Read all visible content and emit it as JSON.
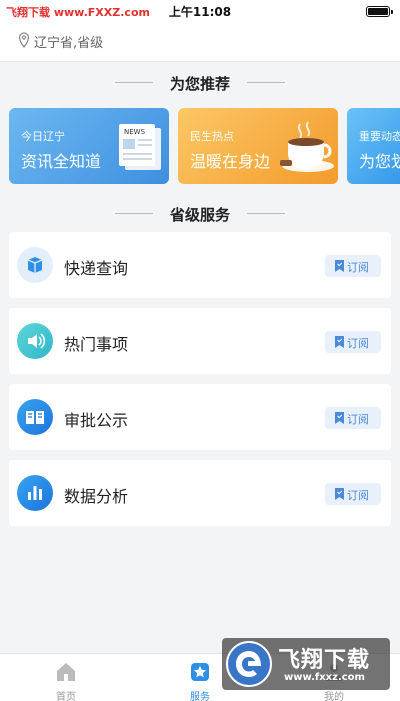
{
  "status_bar": {
    "carrier": "飞翔下载 www.FXXZ.com",
    "time": "上午11:08"
  },
  "location": {
    "text": "辽宁省,省级"
  },
  "recommend": {
    "title": "为您推荐",
    "cards": [
      {
        "sub": "今日辽宁",
        "main": "资讯全知道",
        "badge": "NEWS"
      },
      {
        "sub": "民生热点",
        "main": "温暖在身边"
      },
      {
        "sub": "重要动态",
        "main": "为您划"
      }
    ]
  },
  "services": {
    "title": "省级服务",
    "subscribe_label": "订阅",
    "items": [
      {
        "label": "快递查询",
        "icon": "package-icon",
        "color": "#2f8fe6"
      },
      {
        "label": "热门事项",
        "icon": "speaker-icon",
        "color": "#3fc4cf"
      },
      {
        "label": "审批公示",
        "icon": "book-icon",
        "color": "#1f87e8"
      },
      {
        "label": "数据分析",
        "icon": "bar-chart-icon",
        "color": "#1f87e8"
      }
    ]
  },
  "tabs": [
    {
      "label": "首页",
      "icon": "home-icon",
      "active": false
    },
    {
      "label": "服务",
      "icon": "star-icon",
      "active": true
    },
    {
      "label": "我的",
      "icon": "user-icon",
      "active": false
    }
  ],
  "watermark": {
    "brand": "飞翔下载",
    "url": "www.fxxz.com"
  },
  "colors": {
    "accent": "#2f8fe6",
    "tab_active": "#2f8fe6",
    "tab_inactive": "#999999"
  }
}
